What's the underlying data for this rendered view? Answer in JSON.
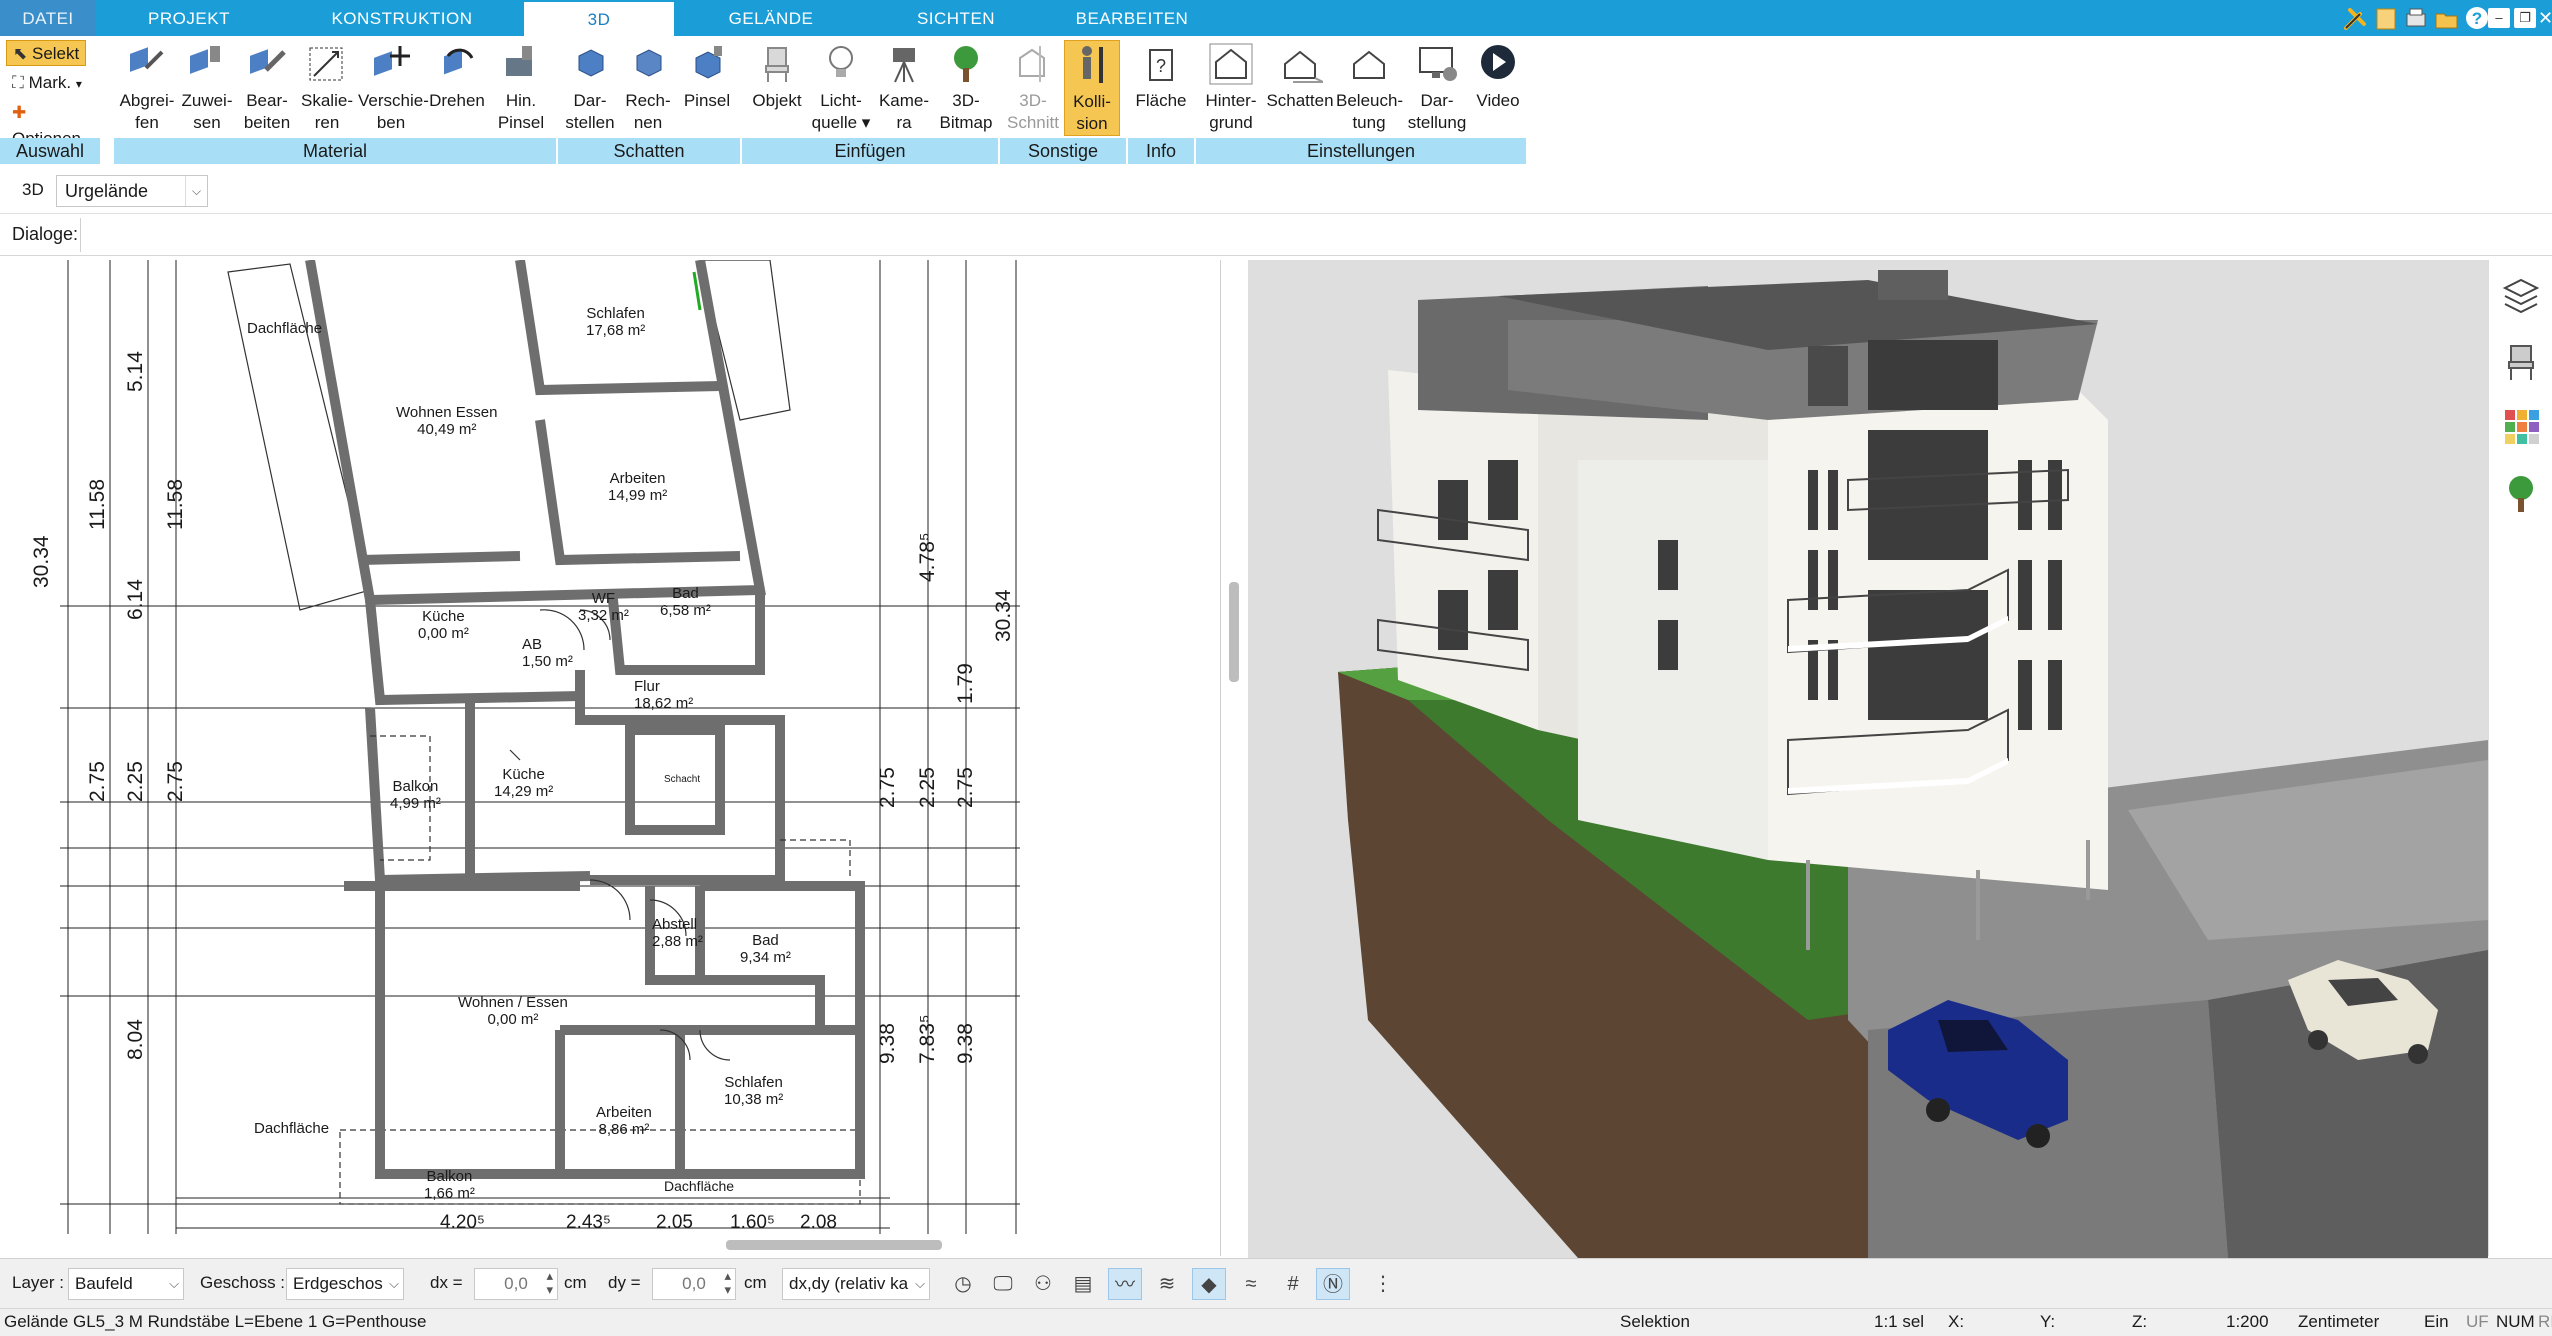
{
  "tabs": {
    "file": "DATEI",
    "items": [
      "PROJEKT",
      "KONSTRUKTION",
      "3D",
      "GELÄNDE",
      "SICHTEN",
      "BEARBEITEN"
    ],
    "active": "3D"
  },
  "ribbon": {
    "auswahl": {
      "label": "Auswahl",
      "selekt": "Selekt",
      "mark": "Mark.",
      "optionen": "Optionen"
    },
    "material": {
      "label": "Material",
      "buttons": [
        {
          "line1": "Abgrei-",
          "line2": "fen"
        },
        {
          "line1": "Zuwei-",
          "line2": "sen"
        },
        {
          "line1": "Bear-",
          "line2": "beiten"
        },
        {
          "line1": "Skalie-",
          "line2": "ren"
        },
        {
          "line1": "Verschie-",
          "line2": "ben"
        },
        {
          "line1": "Drehen",
          "line2": ""
        },
        {
          "line1": "Hin.",
          "line2": "Pinsel"
        }
      ]
    },
    "schatten": {
      "label": "Schatten",
      "buttons": [
        {
          "line1": "Dar-",
          "line2": "stellen"
        },
        {
          "line1": "Rech-",
          "line2": "nen"
        },
        {
          "line1": "Pinsel",
          "line2": ""
        }
      ]
    },
    "einfuegen": {
      "label": "Einfügen",
      "buttons": [
        {
          "line1": "Objekt",
          "line2": ""
        },
        {
          "line1": "Licht-",
          "line2": "quelle ▾"
        },
        {
          "line1": "Kame-",
          "line2": "ra"
        },
        {
          "line1": "3D-",
          "line2": "Bitmap"
        }
      ]
    },
    "sonstige": {
      "label": "Sonstige",
      "buttons": [
        {
          "line1": "3D-",
          "line2": "Schnitt"
        },
        {
          "line1": "Kolli-",
          "line2": "sion"
        }
      ]
    },
    "info": {
      "label": "Info",
      "buttons": [
        {
          "line1": "Fläche",
          "line2": ""
        }
      ]
    },
    "einstellungen": {
      "label": "Einstellungen",
      "buttons": [
        {
          "line1": "Hinter-",
          "line2": "grund"
        },
        {
          "line1": "Schatten",
          "line2": ""
        },
        {
          "line1": "Beleuch-",
          "line2": "tung"
        },
        {
          "line1": "Dar-",
          "line2": "stellung"
        },
        {
          "line1": "Video",
          "line2": ""
        }
      ]
    }
  },
  "row3d": {
    "mode": "3D",
    "combo": "Urgelände"
  },
  "dialoge": {
    "label": "Dialoge:"
  },
  "plan": {
    "rooms": [
      {
        "name": "Dachfläche",
        "area": ""
      },
      {
        "name": "Schlafen",
        "area": "17,68 m²"
      },
      {
        "name": "Wohnen Essen",
        "area": "40,49 m²"
      },
      {
        "name": "Arbeiten",
        "area": "14,99 m²"
      },
      {
        "name": "Bad",
        "area": "6,58 m²"
      },
      {
        "name": "WF",
        "area": "3,32 m²"
      },
      {
        "name": "Küche",
        "area": "0,00 m²"
      },
      {
        "name": "AB",
        "area": "1,50 m²"
      },
      {
        "name": "Flur",
        "area": "18,62 m²"
      },
      {
        "name": "Balkon",
        "area": "4,99 m²"
      },
      {
        "name": "Küche",
        "area": "14,29 m²"
      },
      {
        "name": "Schacht",
        "area": ""
      },
      {
        "name": "Abstell",
        "area": "2,88 m²"
      },
      {
        "name": "Bad",
        "area": "9,34 m²"
      },
      {
        "name": "Wohnen / Essen",
        "area": "0,00 m²"
      },
      {
        "name": "Schlafen",
        "area": "10,38 m²"
      },
      {
        "name": "Arbeiten",
        "area": "8,86 m²"
      },
      {
        "name": "Dachfläche",
        "area": ""
      },
      {
        "name": "Balkon",
        "area": "1,66 m²"
      },
      {
        "name": "Dachfläche",
        "area": ""
      }
    ],
    "dims_left": [
      "30.34",
      "11.58",
      "11.58",
      "5.14",
      "6.14",
      "2.75",
      "2.25",
      "2.75",
      "8.04"
    ],
    "dims_right": [
      "30.34",
      "4.78⁵",
      "1.79",
      "2.75",
      "2.25",
      "2.75",
      "9.38",
      "7.83⁵",
      "9.38"
    ],
    "dims_bottom": [
      "4.20⁵",
      "2.43⁵",
      "2.05",
      "1.60⁵",
      "2.08"
    ]
  },
  "bottom": {
    "layer_label": "Layer :",
    "layer_value": "Baufeld",
    "geschoss_label": "Geschoss :",
    "geschoss_value": "Erdgeschos",
    "dx_label": "dx =",
    "dx_value": "0,0",
    "dy_label": "dy =",
    "dy_value": "0,0",
    "unit": "cm",
    "mode": "dx,dy (relativ ka"
  },
  "status": {
    "left": "Gelände GL5_3 M Rundstäbe L=Ebene 1 G=Penthouse",
    "selektion": "Selektion",
    "sel": "1:1 sel",
    "x": "X:",
    "y": "Y:",
    "z": "Z:",
    "scale": "1:200",
    "unit": "Zentimeter",
    "ein": "Ein",
    "uf": "UF",
    "num": "NUM",
    "ri": "RI"
  },
  "colors": {
    "tabbar": "#1b9ed8",
    "group_label": "#a9dff6",
    "active_button": "#f6c653"
  }
}
